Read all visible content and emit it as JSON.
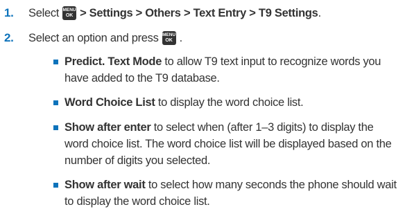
{
  "steps": [
    {
      "num": "1.",
      "prefix": "Select",
      "icon": {
        "line1": "MENU",
        "line2": "OK"
      },
      "path": "> Settings > Others > Text Entry > T9 Settings",
      "suffix": "."
    },
    {
      "num": "2.",
      "text": "Select an option and press",
      "icon": {
        "line1": "MENU",
        "line2": "OK"
      },
      "suffix": "."
    }
  ],
  "options": [
    {
      "term": "Predict. Text Mode",
      "desc": " to allow T9 text input to recognize words you have added to the T9 database."
    },
    {
      "term": "Word Choice List",
      "desc": " to display the word choice list."
    },
    {
      "term": "Show after enter",
      "desc": " to select when (after 1–3 digits) to display the word choice list. The word choice list will be displayed based on the number of digits you selected."
    },
    {
      "term": "Show after wait",
      "desc": " to select how many seconds the phone should wait to display the word choice list."
    }
  ],
  "colors": {
    "accent": "#0d73bb",
    "text": "#333333",
    "icon_bg": "#333333"
  },
  "icons": [
    "menu-ok-key-icon",
    "square-bullet-icon"
  ]
}
